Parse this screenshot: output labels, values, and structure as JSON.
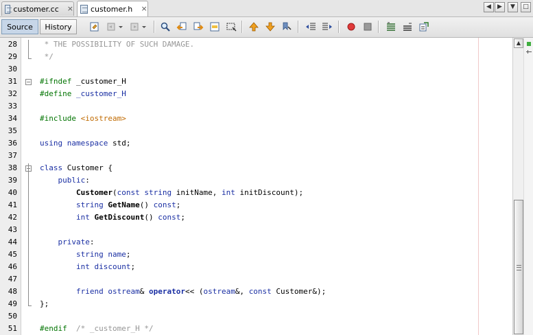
{
  "tabs": [
    {
      "label": "customer.cc",
      "active": false
    },
    {
      "label": "customer.h",
      "active": true
    }
  ],
  "tab_close_glyph": "×",
  "nav_buttons": [
    "◀",
    "▶",
    "▼",
    "□"
  ],
  "toolbar": {
    "source_label": "Source",
    "history_label": "History"
  },
  "code_lines": [
    {
      "n": "28",
      "segments": [
        {
          "t": " * THE POSSIBILITY OF SUCH DAMAGE.",
          "c": "cm"
        }
      ]
    },
    {
      "n": "29",
      "segments": [
        {
          "t": " */",
          "c": "cm"
        }
      ]
    },
    {
      "n": "30",
      "segments": []
    },
    {
      "n": "31",
      "segments": [
        {
          "t": "#ifndef",
          "c": "pp"
        },
        {
          "t": " _customer_H",
          "c": ""
        }
      ]
    },
    {
      "n": "32",
      "segments": [
        {
          "t": "#define",
          "c": "pp"
        },
        {
          "t": " ",
          "c": ""
        },
        {
          "t": "_customer_H",
          "c": "kw"
        }
      ]
    },
    {
      "n": "33",
      "segments": []
    },
    {
      "n": "34",
      "segments": [
        {
          "t": "#include",
          "c": "pp"
        },
        {
          "t": " ",
          "c": ""
        },
        {
          "t": "<iostream>",
          "c": "str"
        }
      ]
    },
    {
      "n": "35",
      "segments": []
    },
    {
      "n": "36",
      "segments": [
        {
          "t": "using",
          "c": "kw"
        },
        {
          "t": " ",
          "c": ""
        },
        {
          "t": "namespace",
          "c": "kw"
        },
        {
          "t": " std;",
          "c": ""
        }
      ]
    },
    {
      "n": "37",
      "segments": []
    },
    {
      "n": "38",
      "segments": [
        {
          "t": "class",
          "c": "kw"
        },
        {
          "t": " Customer {",
          "c": ""
        }
      ]
    },
    {
      "n": "39",
      "segments": [
        {
          "t": "    ",
          "c": ""
        },
        {
          "t": "public",
          "c": "kw"
        },
        {
          "t": ":",
          "c": ""
        }
      ]
    },
    {
      "n": "40",
      "segments": [
        {
          "t": "        ",
          "c": ""
        },
        {
          "t": "Customer",
          "c": "b"
        },
        {
          "t": "(",
          "c": ""
        },
        {
          "t": "const",
          "c": "kw"
        },
        {
          "t": " ",
          "c": ""
        },
        {
          "t": "string",
          "c": "kw"
        },
        {
          "t": " initName, ",
          "c": ""
        },
        {
          "t": "int",
          "c": "kw"
        },
        {
          "t": " initDiscount);",
          "c": ""
        }
      ]
    },
    {
      "n": "41",
      "segments": [
        {
          "t": "        ",
          "c": ""
        },
        {
          "t": "string",
          "c": "kw"
        },
        {
          "t": " ",
          "c": ""
        },
        {
          "t": "GetName",
          "c": "b"
        },
        {
          "t": "() ",
          "c": ""
        },
        {
          "t": "const",
          "c": "kw"
        },
        {
          "t": ";",
          "c": ""
        }
      ]
    },
    {
      "n": "42",
      "segments": [
        {
          "t": "        ",
          "c": ""
        },
        {
          "t": "int",
          "c": "kw"
        },
        {
          "t": " ",
          "c": ""
        },
        {
          "t": "GetDiscount",
          "c": "b"
        },
        {
          "t": "() ",
          "c": ""
        },
        {
          "t": "const",
          "c": "kw"
        },
        {
          "t": ";",
          "c": ""
        }
      ]
    },
    {
      "n": "43",
      "segments": []
    },
    {
      "n": "44",
      "segments": [
        {
          "t": "    ",
          "c": ""
        },
        {
          "t": "private",
          "c": "kw"
        },
        {
          "t": ":",
          "c": ""
        }
      ]
    },
    {
      "n": "45",
      "segments": [
        {
          "t": "        ",
          "c": ""
        },
        {
          "t": "string",
          "c": "kw"
        },
        {
          "t": " ",
          "c": ""
        },
        {
          "t": "name",
          "c": "kw"
        },
        {
          "t": ";",
          "c": ""
        }
      ]
    },
    {
      "n": "46",
      "segments": [
        {
          "t": "        ",
          "c": ""
        },
        {
          "t": "int",
          "c": "kw"
        },
        {
          "t": " ",
          "c": ""
        },
        {
          "t": "discount",
          "c": "kw"
        },
        {
          "t": ";",
          "c": ""
        }
      ]
    },
    {
      "n": "47",
      "segments": []
    },
    {
      "n": "48",
      "segments": [
        {
          "t": "        ",
          "c": ""
        },
        {
          "t": "friend",
          "c": "kw"
        },
        {
          "t": " ",
          "c": ""
        },
        {
          "t": "ostream",
          "c": "kw"
        },
        {
          "t": "& ",
          "c": ""
        },
        {
          "t": "operator",
          "c": "b kw"
        },
        {
          "t": "<< (",
          "c": ""
        },
        {
          "t": "ostream",
          "c": "kw"
        },
        {
          "t": "&, ",
          "c": ""
        },
        {
          "t": "const",
          "c": "kw"
        },
        {
          "t": " Customer&);",
          "c": ""
        }
      ]
    },
    {
      "n": "49",
      "segments": [
        {
          "t": "};",
          "c": ""
        }
      ]
    },
    {
      "n": "50",
      "segments": []
    },
    {
      "n": "51",
      "segments": [
        {
          "t": "#endif",
          "c": "pp"
        },
        {
          "t": "  ",
          "c": ""
        },
        {
          "t": "/* _customer_H */",
          "c": "cm"
        }
      ]
    }
  ],
  "scroll": {
    "up_glyph": "▲",
    "down_glyph": "▼"
  },
  "colors": {
    "keyword": "#1a2fa3",
    "preprocessor": "#027402",
    "string": "#c06a00",
    "comment": "#969696",
    "selected_mode": "#c7d6e8"
  }
}
